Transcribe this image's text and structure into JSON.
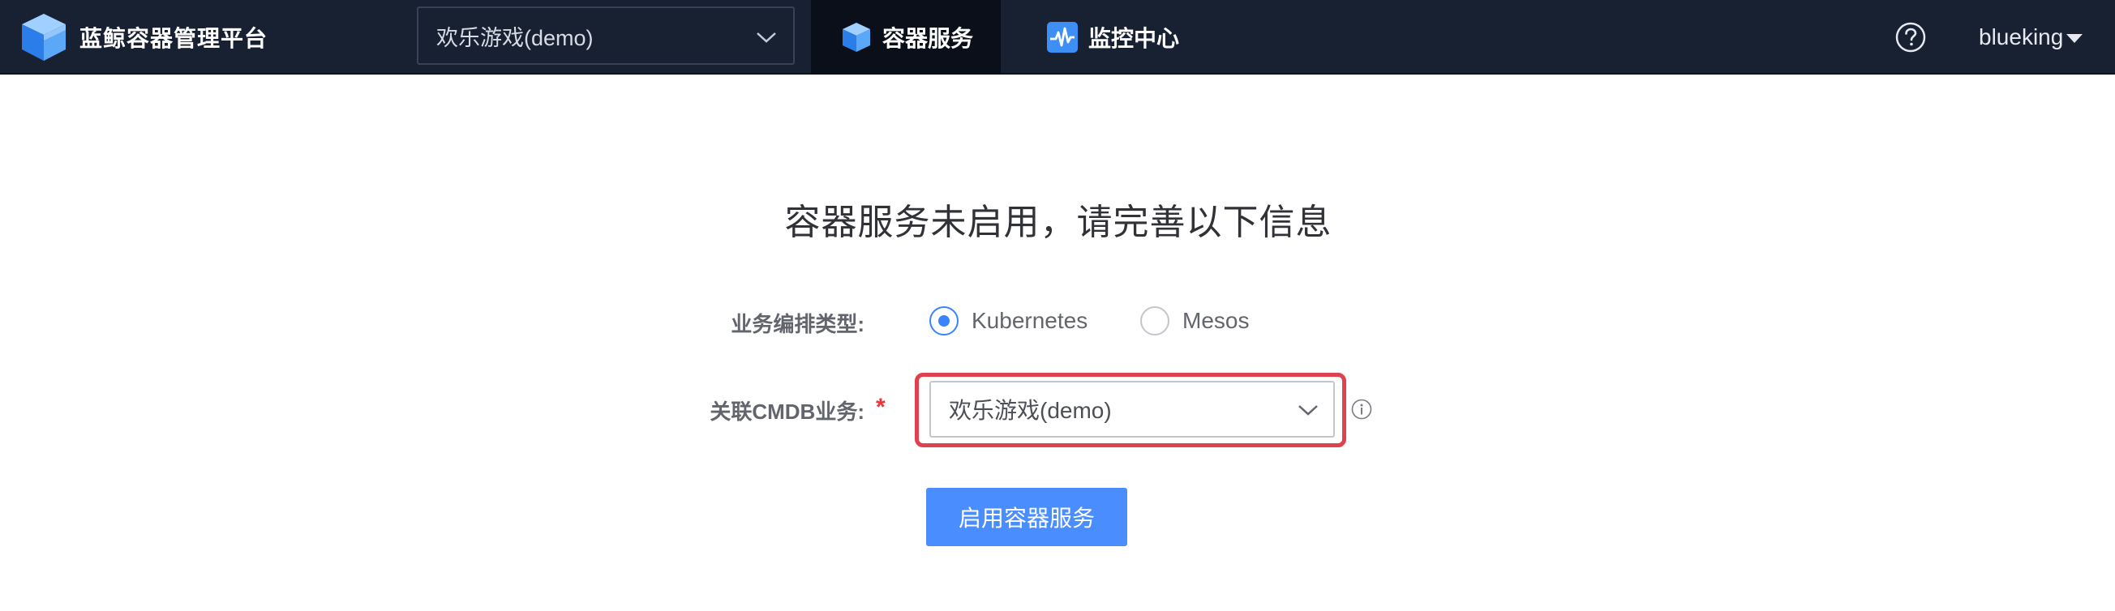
{
  "header": {
    "brand_name": "蓝鲸容器管理平台",
    "project_select": {
      "value": "欢乐游戏(demo)"
    },
    "tabs": [
      {
        "label": "容器服务",
        "icon": "cube-icon",
        "active": true
      },
      {
        "label": "监控中心",
        "icon": "monitor-pulse-icon",
        "active": false
      }
    ],
    "help_icon": "question-circle-icon",
    "username": "blueking"
  },
  "main": {
    "title": "容器服务未启用，请完善以下信息",
    "orchestration": {
      "label": "业务编排类型:",
      "options": [
        {
          "label": "Kubernetes",
          "checked": true
        },
        {
          "label": "Mesos",
          "checked": false
        }
      ]
    },
    "cmdb": {
      "label": "关联CMDB业务:",
      "required_mark": "*",
      "value": "欢乐游戏(demo)"
    },
    "submit_label": "启用容器服务"
  },
  "colors": {
    "topbar_bg": "#182132",
    "active_tab_bg": "#0a0f1a",
    "primary": "#3a84ff",
    "highlight_border": "#e0414f",
    "required": "#ea3636"
  }
}
